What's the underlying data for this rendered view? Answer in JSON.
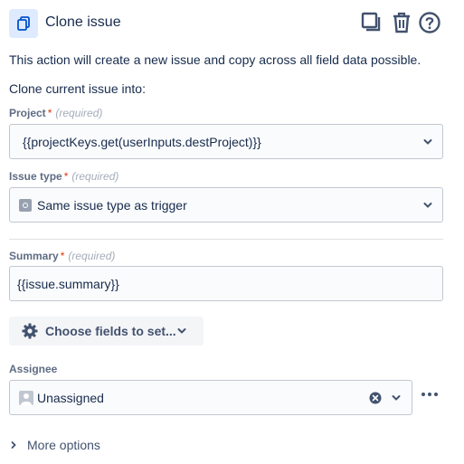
{
  "header": {
    "title": "Clone issue",
    "icons": [
      "clone-icon",
      "copy-icon",
      "trash-icon",
      "help-icon"
    ],
    "accent_color": "#deebff",
    "icon_color": "#0052cc"
  },
  "description": "This action will create a new issue and copy across all field data possible.",
  "subheading": "Clone current issue into:",
  "project": {
    "label": "Project",
    "required_mark": "*",
    "required_text": "(required)",
    "value": "{{projectKeys.get(userInputs.destProject)}}"
  },
  "issue_type": {
    "label": "Issue type",
    "required_mark": "*",
    "required_text": "(required)",
    "value": "Same issue type as trigger"
  },
  "summary": {
    "label": "Summary",
    "required_mark": "*",
    "required_text": "(required)",
    "value": "{{issue.summary}}"
  },
  "choose_fields": {
    "label": "Choose fields to set..."
  },
  "assignee": {
    "label": "Assignee",
    "value": "Unassigned"
  },
  "more_options": {
    "label": "More options"
  }
}
